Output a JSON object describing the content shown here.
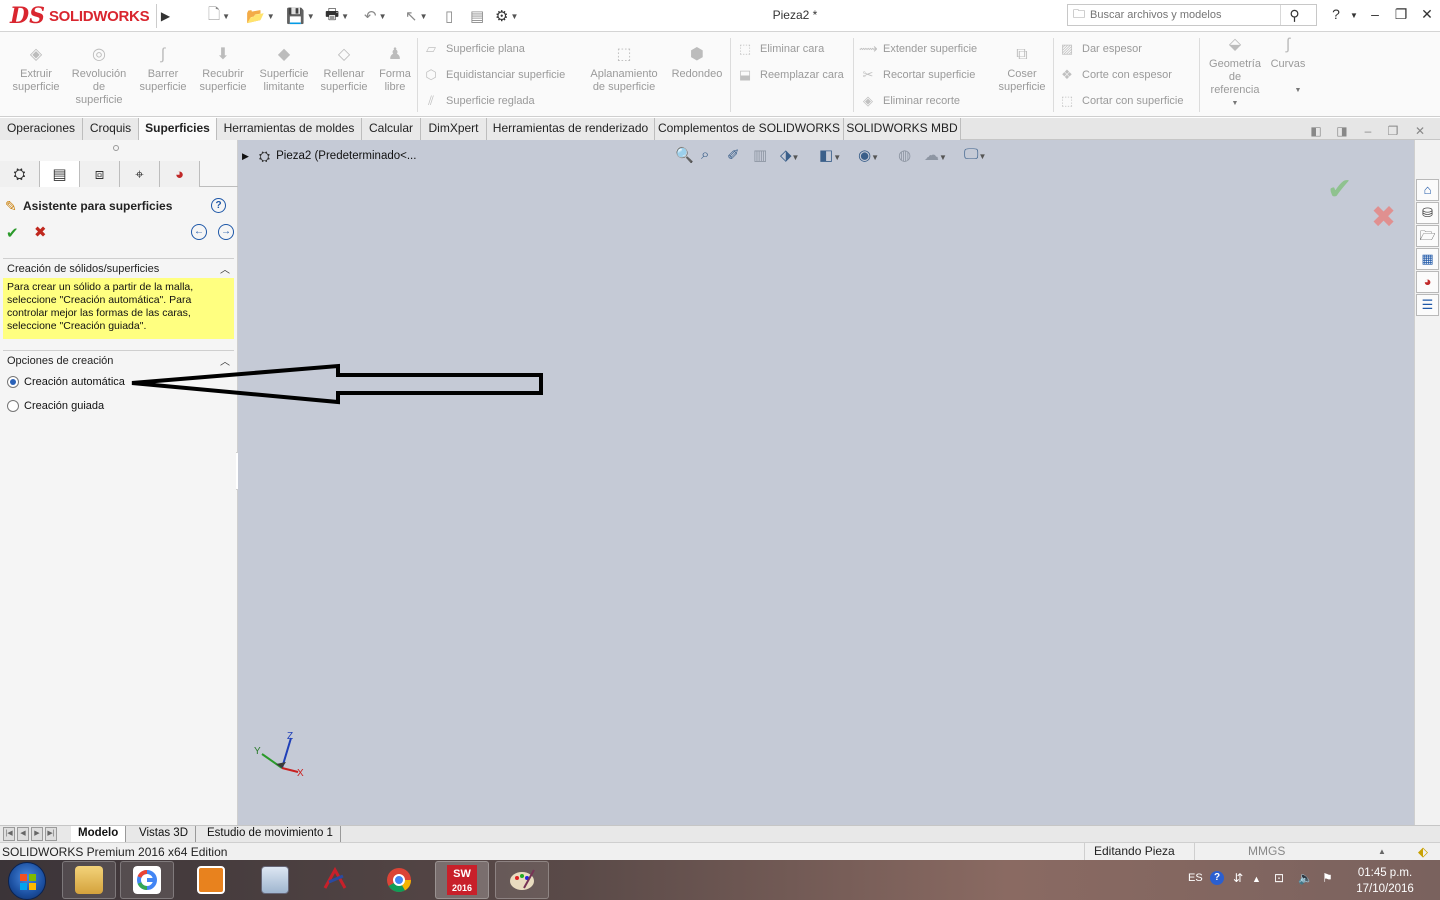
{
  "app": {
    "brand_ds": "DS",
    "brand_name": "SOLIDWORKS",
    "document_title": "Pieza2 *",
    "search_placeholder": "Buscar archivos y modelos"
  },
  "ribbon": {
    "big_buttons": [
      {
        "label": "Extruir\nsuperficie"
      },
      {
        "label": "Revolución\nde\nsuperficie"
      },
      {
        "label": "Barrer\nsuperficie"
      },
      {
        "label": "Recubrir\nsuperficie"
      },
      {
        "label": "Superficie\nlimitante"
      },
      {
        "label": "Rellenar\nsuperficie"
      },
      {
        "label": "Forma\nlibre"
      }
    ],
    "group_a": [
      "Superficie plana",
      "Equidistanciar superficie",
      "Superficie reglada"
    ],
    "aplanamiento": "Aplanamiento\nde superficie",
    "redondeo": "Redondeo",
    "group_b": [
      "Eliminar cara",
      "Reemplazar cara"
    ],
    "group_c": [
      "Extender superficie",
      "Recortar superficie",
      "Eliminar recorte"
    ],
    "coser": "Coser\nsuperficie",
    "group_d": [
      "Dar espesor",
      "Corte con espesor",
      "Cortar con superficie"
    ],
    "geometria": "Geometría\nde\nreferencia",
    "curvas": "Curvas"
  },
  "tabs": [
    {
      "label": "Operaciones",
      "active": false
    },
    {
      "label": "Croquis",
      "active": false
    },
    {
      "label": "Superficies",
      "active": true
    },
    {
      "label": "Herramientas de moldes",
      "active": false
    },
    {
      "label": "Calcular",
      "active": false
    },
    {
      "label": "DimXpert",
      "active": false
    },
    {
      "label": "Herramientas de renderizado",
      "active": false
    },
    {
      "label": "Complementos de SOLIDWORKS",
      "active": false
    },
    {
      "label": "SOLIDWORKS MBD",
      "active": false
    }
  ],
  "property_manager": {
    "title": "Asistente para superficies",
    "group1": {
      "title": "Creación de sólidos/superficies",
      "message": "Para crear un sólido a partir de la malla, seleccione \"Creación automática\". Para controlar mejor las formas de las caras, seleccione \"Creación guiada\"."
    },
    "group2": {
      "title": "Opciones de creación",
      "options": [
        {
          "label": "Creación automática",
          "selected": true
        },
        {
          "label": "Creación guiada",
          "selected": false
        }
      ]
    }
  },
  "feature_tree": {
    "label": "Pieza2  (Predeterminado<..."
  },
  "axes": {
    "x": "X",
    "y": "Y",
    "z": "Z"
  },
  "bottom_tabs": [
    {
      "label": "Modelo",
      "active": true
    },
    {
      "label": "Vistas 3D",
      "active": false
    },
    {
      "label": "Estudio de movimiento 1",
      "active": false
    }
  ],
  "status": {
    "edition": "SOLIDWORKS Premium 2016 x64 Edition",
    "mode": "Editando Pieza",
    "units": "MMGS"
  },
  "taskbar": {
    "language": "ES",
    "time": "01:45 p.m.",
    "date": "17/10/2016",
    "sw_badge": "2016"
  },
  "colors": {
    "brand_red": "#d9262f",
    "viewport_bg": "#c5cad6",
    "message_yellow": "#ffff80",
    "accent_blue": "#1f58a8"
  }
}
